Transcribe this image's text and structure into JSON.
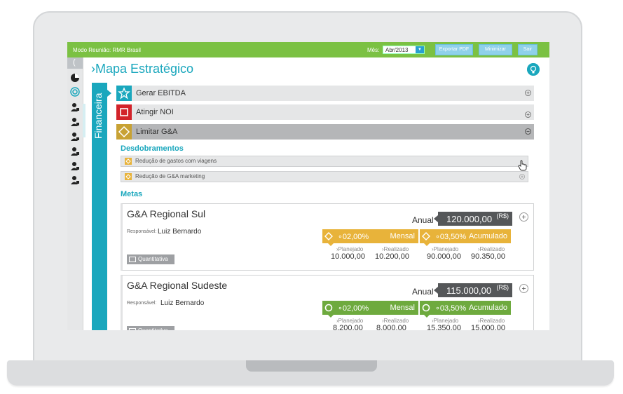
{
  "topbar": {
    "mode": "Modo Reunião: RMR Brasil",
    "mes_label": "Mês:",
    "mes_value": "Abr/2013",
    "export_pdf": "Exportar PDF",
    "minimize": "Minimizar",
    "exit": "Sair"
  },
  "page_title": "›Mapa Estratégico",
  "perspective": "Financeira",
  "objectives": [
    {
      "label": "Gerar EBITDA",
      "color": "#1aa7bd"
    },
    {
      "label": "Atingir NOI",
      "color": "#d2232a"
    },
    {
      "label": "Limitar G&A",
      "color": "#c8a234"
    }
  ],
  "desdobramentos": {
    "title": "Desdobramentos",
    "items": [
      "Redução de gastos com viagens",
      "Redução de G&A marketing"
    ]
  },
  "metas": {
    "title": "Metas",
    "responsavel_label": "Responsável:",
    "anual_label": "Anual",
    "currency": "(R$)",
    "type_label": "Quantitativa",
    "planejado_label": "›Planejado",
    "realizado_label": "›Realizado",
    "items": [
      {
        "title": "G&A Regional Sul",
        "responsavel": "Luiz Bernardo",
        "anual": "120.000,00",
        "status_color": "#e8b33a",
        "mensal": {
          "pct": "∘02,00%",
          "label": "Mensal",
          "planejado": "10.000,00",
          "realizado": "10.200,00"
        },
        "acumulado": {
          "pct": "∘03,50%",
          "label": "Acumulado",
          "planejado": "90.000,00",
          "realizado": "90.350,00"
        }
      },
      {
        "title": "G&A Regional Sudeste",
        "responsavel": "Luiz Bernardo",
        "anual": "115.000,00",
        "status_color": "#6eaa3e",
        "mensal": {
          "pct": "∘02,00%",
          "label": "Mensal",
          "planejado": "8.200,00",
          "realizado": "8.000,00"
        },
        "acumulado": {
          "pct": "∘03,50%",
          "label": "Acumulado",
          "planejado": "15.350,00",
          "realizado": "15.000,00"
        }
      }
    ]
  }
}
